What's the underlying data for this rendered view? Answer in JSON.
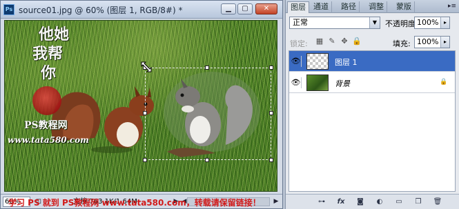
{
  "document": {
    "title": "source01.jpg @ 60% (图层 1, RGB/8#) *",
    "app_icon": "Ps",
    "window_buttons": {
      "minimize": "▁",
      "maximize": "▢",
      "close": "✕"
    },
    "canvas_watermark": {
      "calligraphy_lines": [
        "他她",
        "我帮",
        "你"
      ],
      "subtitle": "PS教程网",
      "url": "www.tata580.com"
    },
    "status": {
      "zoom": "60%",
      "doc_info": "文档:763.1K/1.64M",
      "left_arrow": "◀",
      "right_arrow": "▶"
    },
    "footer_watermark": "学习 PS 就到 PS教程网 www.tata580.com，转载请保留链接！"
  },
  "layers_panel": {
    "tabs": [
      {
        "label": "图层",
        "active": true
      },
      {
        "label": "通道",
        "active": false
      },
      {
        "label": "路径",
        "active": false
      },
      {
        "label": "调整",
        "active": false
      },
      {
        "label": "蒙版",
        "active": false
      }
    ],
    "menu_button": "▸≡",
    "blend_mode": "正常",
    "opacity_label": "不透明度:",
    "opacity_value": "100%",
    "lock_label": "锁定:",
    "lock_icons": [
      "lock-transparent-pixels-icon",
      "brush-icon",
      "move-icon",
      "lock-icon"
    ],
    "fill_label": "填充:",
    "fill_value": "100%",
    "layers": [
      {
        "name": "图层 1",
        "visible": true,
        "selected": true,
        "thumb": "transparent"
      },
      {
        "name": "背景",
        "visible": true,
        "selected": false,
        "thumb": "grass",
        "locked": true
      }
    ],
    "footer_buttons": [
      "link-icon",
      "fx-icon",
      "mask-icon",
      "adjustment-icon",
      "group-icon",
      "new-layer-icon",
      "trash-icon"
    ],
    "footer_glyphs": {
      "link": "⊶",
      "fx": "fx",
      "mask": "◙",
      "adjust": "◐",
      "group": "▭",
      "new": "❒",
      "trash": "🗑"
    },
    "eye_glyph": "👁",
    "lock_glyph": "🔒"
  }
}
